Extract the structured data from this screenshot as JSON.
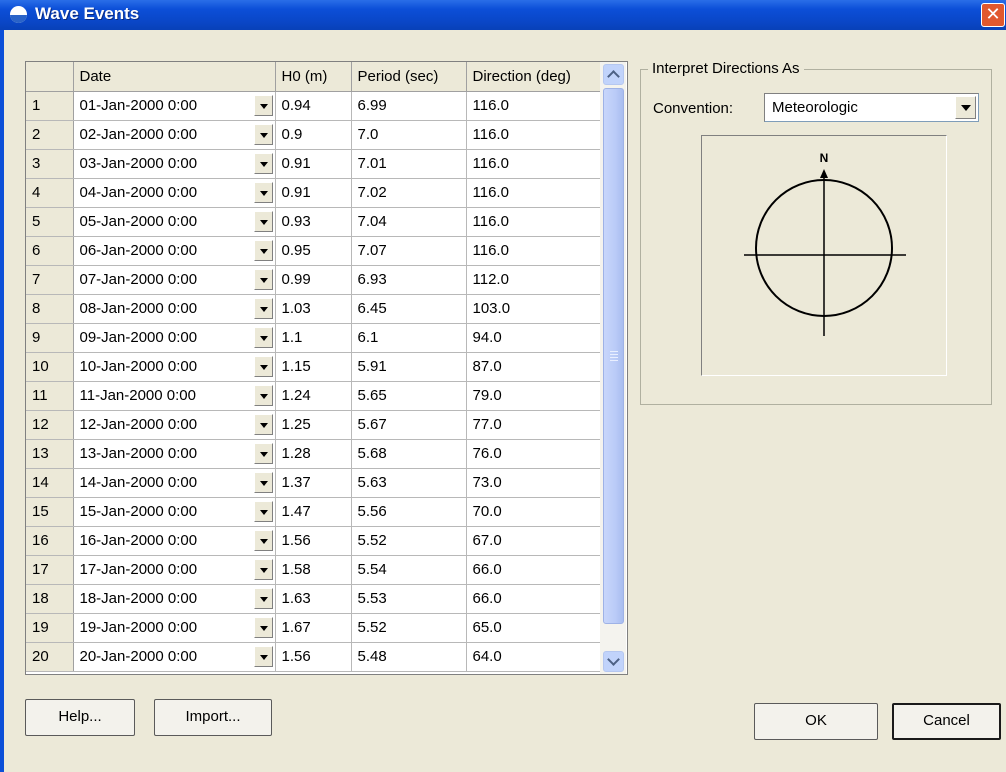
{
  "window": {
    "title": "Wave Events",
    "close_symbol": "✕",
    "icon": "wave-icon"
  },
  "grid": {
    "columns": [
      "",
      "Date",
      "H0 (m)",
      "Period (sec)",
      "Direction (deg)"
    ],
    "rows": [
      {
        "n": "1",
        "date": "01-Jan-2000 0:00",
        "h0": "0.94",
        "period": "6.99",
        "dir": "116.0"
      },
      {
        "n": "2",
        "date": "02-Jan-2000 0:00",
        "h0": "0.9",
        "period": "7.0",
        "dir": "116.0"
      },
      {
        "n": "3",
        "date": "03-Jan-2000 0:00",
        "h0": "0.91",
        "period": "7.01",
        "dir": "116.0"
      },
      {
        "n": "4",
        "date": "04-Jan-2000 0:00",
        "h0": "0.91",
        "period": "7.02",
        "dir": "116.0"
      },
      {
        "n": "5",
        "date": "05-Jan-2000 0:00",
        "h0": "0.93",
        "period": "7.04",
        "dir": "116.0"
      },
      {
        "n": "6",
        "date": "06-Jan-2000 0:00",
        "h0": "0.95",
        "period": "7.07",
        "dir": "116.0"
      },
      {
        "n": "7",
        "date": "07-Jan-2000 0:00",
        "h0": "0.99",
        "period": "6.93",
        "dir": "112.0"
      },
      {
        "n": "8",
        "date": "08-Jan-2000 0:00",
        "h0": "1.03",
        "period": "6.45",
        "dir": "103.0"
      },
      {
        "n": "9",
        "date": "09-Jan-2000 0:00",
        "h0": "1.1",
        "period": "6.1",
        "dir": "94.0"
      },
      {
        "n": "10",
        "date": "10-Jan-2000 0:00",
        "h0": "1.15",
        "period": "5.91",
        "dir": "87.0"
      },
      {
        "n": "11",
        "date": "11-Jan-2000 0:00",
        "h0": "1.24",
        "period": "5.65",
        "dir": "79.0"
      },
      {
        "n": "12",
        "date": "12-Jan-2000 0:00",
        "h0": "1.25",
        "period": "5.67",
        "dir": "77.0"
      },
      {
        "n": "13",
        "date": "13-Jan-2000 0:00",
        "h0": "1.28",
        "period": "5.68",
        "dir": "76.0"
      },
      {
        "n": "14",
        "date": "14-Jan-2000 0:00",
        "h0": "1.37",
        "period": "5.63",
        "dir": "73.0"
      },
      {
        "n": "15",
        "date": "15-Jan-2000 0:00",
        "h0": "1.47",
        "period": "5.56",
        "dir": "70.0"
      },
      {
        "n": "16",
        "date": "16-Jan-2000 0:00",
        "h0": "1.56",
        "period": "5.52",
        "dir": "67.0"
      },
      {
        "n": "17",
        "date": "17-Jan-2000 0:00",
        "h0": "1.58",
        "period": "5.54",
        "dir": "66.0"
      },
      {
        "n": "18",
        "date": "18-Jan-2000 0:00",
        "h0": "1.63",
        "period": "5.53",
        "dir": "66.0"
      },
      {
        "n": "19",
        "date": "19-Jan-2000 0:00",
        "h0": "1.67",
        "period": "5.52",
        "dir": "65.0"
      },
      {
        "n": "20",
        "date": "20-Jan-2000 0:00",
        "h0": "1.56",
        "period": "5.48",
        "dir": "64.0"
      }
    ]
  },
  "directions": {
    "group_label": "Interpret Directions As",
    "convention_label": "Convention:",
    "convention_value": "Meteorologic",
    "north_label": "N"
  },
  "buttons": {
    "help": "Help...",
    "import": "Import...",
    "ok": "OK",
    "cancel": "Cancel"
  },
  "colors": {
    "titlebar": "#0c4fd8",
    "dialog_bg": "#ece9d8",
    "close_button": "#e1582e",
    "scrollbar_thumb": "#bacbf7"
  }
}
